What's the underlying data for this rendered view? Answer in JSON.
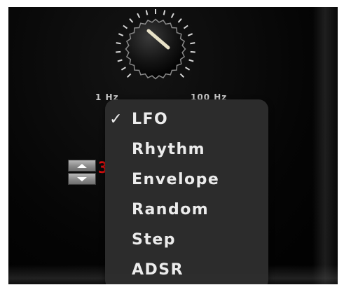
{
  "knob": {
    "min_label": "1 Hz",
    "max_label": "100 Hz"
  },
  "stepper": {
    "up_icon": "triangle-up-icon",
    "down_icon": "triangle-down-icon",
    "value_digit": "3"
  },
  "menu": {
    "checkmark": "✓",
    "items": [
      {
        "label": "LFO",
        "checked": true
      },
      {
        "label": "Rhythm",
        "checked": false
      },
      {
        "label": "Envelope",
        "checked": false
      },
      {
        "label": "Random",
        "checked": false
      },
      {
        "label": "Step",
        "checked": false
      },
      {
        "label": "ADSR",
        "checked": false
      }
    ]
  },
  "colors": {
    "panel": "#000000",
    "menu_bg": "#2e2e2e",
    "menu_text": "#ececec",
    "digit_red": "#e01010"
  }
}
